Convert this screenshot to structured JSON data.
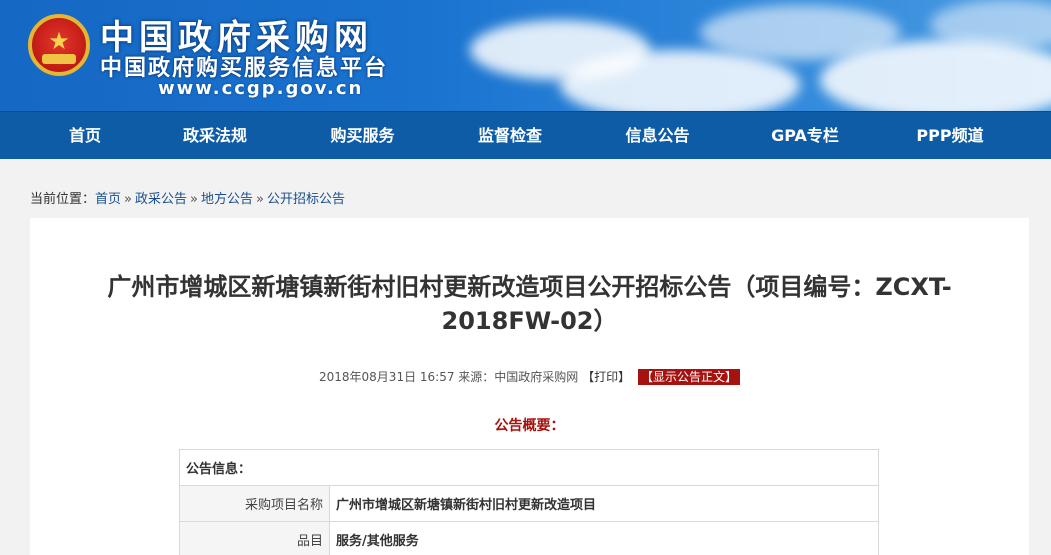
{
  "header": {
    "site_title": "中国政府采购网",
    "site_subtitle": "中国政府购买服务信息平台",
    "site_url": "www.ccgp.gov.cn"
  },
  "nav": {
    "items": [
      {
        "label": "首页"
      },
      {
        "label": "政采法规"
      },
      {
        "label": "购买服务"
      },
      {
        "label": "监督检查"
      },
      {
        "label": "信息公告"
      },
      {
        "label": "GPA专栏"
      },
      {
        "label": "PPP频道"
      }
    ]
  },
  "breadcrumb": {
    "prefix": "当前位置：",
    "items": [
      "首页",
      "政采公告",
      "地方公告",
      "公开招标公告"
    ],
    "separator": "»"
  },
  "article": {
    "title": "广州市增城区新塘镇新街村旧村更新改造项目公开招标公告（项目编号：ZCXT-2018FW-02）",
    "meta_text": "2018年08月31日 16:57 来源：中国政府采购网",
    "print_label": "【打印】",
    "show_body_label": "【显示公告正文】",
    "summary_label": "公告概要："
  },
  "info_table": {
    "header": "公告信息：",
    "rows": [
      {
        "label": "采购项目名称",
        "value": "广州市增城区新塘镇新街村旧村更新改造项目"
      },
      {
        "label": "品目",
        "value": "服务/其他服务"
      }
    ]
  },
  "colors": {
    "nav_bg": "#0e5ba6",
    "accent_red": "#a5120f",
    "banner_blue": "#1a73cf"
  }
}
